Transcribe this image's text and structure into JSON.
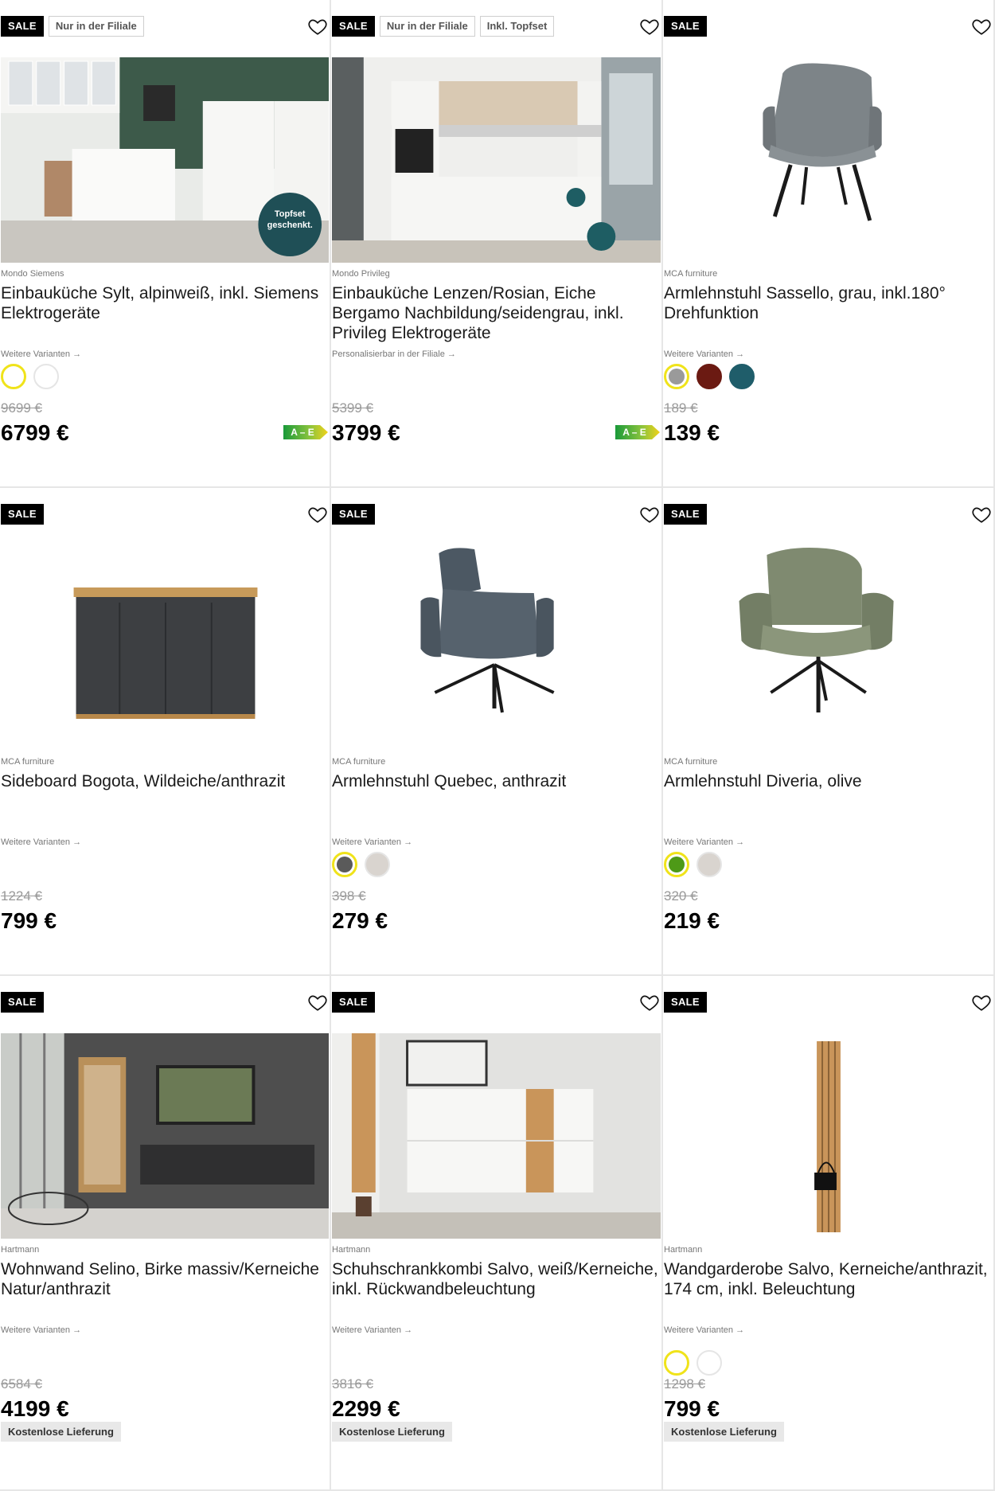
{
  "products": [
    {
      "badges": [
        "SALE",
        "Nur in der Filiale"
      ],
      "brand": "Mondo Siemens",
      "name": "Einbauküche Sylt, alpinweiß, inkl. Siemens Elektrogeräte",
      "variants_label": "Weitere Varianten →",
      "swatches": [
        "#ffffff",
        "#ffffff"
      ],
      "old_price": "9699 €",
      "price": "6799 €",
      "energy": "A – E",
      "image_sticker": "Topfset geschenkt."
    },
    {
      "badges": [
        "SALE",
        "Nur in der Filiale",
        "Inkl. Topfset"
      ],
      "brand": "Mondo Privileg",
      "name": "Einbauküche Lenzen/Rosian, Eiche Bergamo Nachbildung/seidengrau, inkl. Privileg Elektrogeräte",
      "variants_label": "Personalisierbar in der Filiale →",
      "swatches": [],
      "old_price": "5399 €",
      "price": "3799 €",
      "energy": "A – E"
    },
    {
      "badges": [
        "SALE"
      ],
      "brand": "MCA furniture",
      "name": "Armlehnstuhl Sassello, grau, inkl.180° Drehfunktion",
      "variants_label": "Weitere Varianten →",
      "swatches": [
        "#9a9a9a",
        "#6b1a12",
        "#1f5d6a"
      ],
      "old_price": "189 €",
      "price": "139 €"
    },
    {
      "badges": [
        "SALE"
      ],
      "brand": "MCA furniture",
      "name": "Sideboard Bogota, Wildeiche/anthrazit",
      "variants_label": "Weitere Varianten →",
      "swatches": [],
      "old_price": "1224 €",
      "price": "799 €"
    },
    {
      "badges": [
        "SALE"
      ],
      "brand": "MCA furniture",
      "name": "Armlehnstuhl Quebec, anthrazit",
      "variants_label": "Weitere Varianten →",
      "swatches": [
        "#5a5a5a",
        "#d9d4cf"
      ],
      "old_price": "398 €",
      "price": "279 €"
    },
    {
      "badges": [
        "SALE"
      ],
      "brand": "MCA furniture",
      "name": "Armlehnstuhl Diveria, olive",
      "variants_label": "Weitere Varianten →",
      "swatches": [
        "#4e9a17",
        "#d9d4cf"
      ],
      "old_price": "320 €",
      "price": "219 €"
    },
    {
      "badges": [
        "SALE"
      ],
      "brand": "Hartmann",
      "name": "Wohnwand Selino, Birke massiv/Kerneiche Natur/anthrazit",
      "variants_label": "Weitere Varianten →",
      "swatches": [],
      "old_price": "6584 €",
      "price": "4199 €",
      "delivery": "Kostenlose Lieferung"
    },
    {
      "badges": [
        "SALE"
      ],
      "brand": "Hartmann",
      "name": "Schuhschrankkombi Salvo, weiß/Kerneiche, inkl. Rückwandbeleuchtung",
      "variants_label": "Weitere Varianten →",
      "swatches": [],
      "old_price": "3816 €",
      "price": "2299 €",
      "delivery": "Kostenlose Lieferung"
    },
    {
      "badges": [
        "SALE"
      ],
      "brand": "Hartmann",
      "name": "Wandgarderobe Salvo, Kerneiche/anthrazit, 174 cm, inkl. Beleuchtung",
      "variants_label": "Weitere Varianten →",
      "swatches": [
        "#ffffff",
        "#ffffff"
      ],
      "old_price": "1298 €",
      "price": "799 €",
      "delivery": "Kostenlose Lieferung"
    }
  ],
  "colors": {
    "sale_bg": "#000000",
    "selected_ring": "#f0e31a",
    "text": "#111111",
    "muted": "#777777"
  }
}
